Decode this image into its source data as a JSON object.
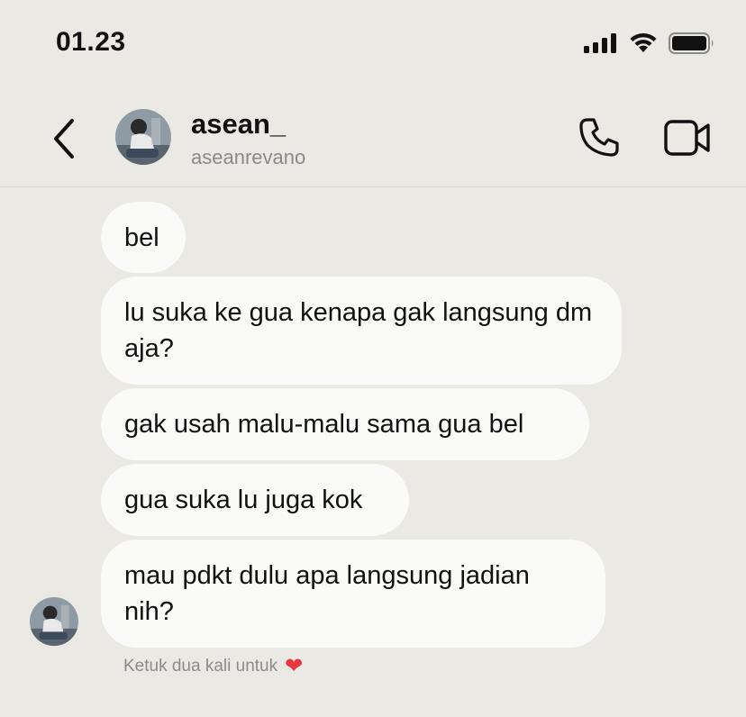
{
  "status_bar": {
    "time": "01.23"
  },
  "header": {
    "name": "asean_",
    "handle": "aseanrevano"
  },
  "messages": [
    {
      "text": "bel"
    },
    {
      "text": "lu suka ke gua kenapa gak langsung dm aja?"
    },
    {
      "text": "gak usah malu-malu sama gua bel"
    },
    {
      "text": "gua suka lu juga kok"
    },
    {
      "text": "mau pdkt dulu apa langsung jadian nih?"
    }
  ],
  "hint": {
    "text": "Ketuk dua kali untuk",
    "icon": "heart-icon",
    "heart_glyph": "❤"
  },
  "colors": {
    "background": "#ebe9e4",
    "bubble": "#fafaf9",
    "heart": "#e8353f"
  }
}
